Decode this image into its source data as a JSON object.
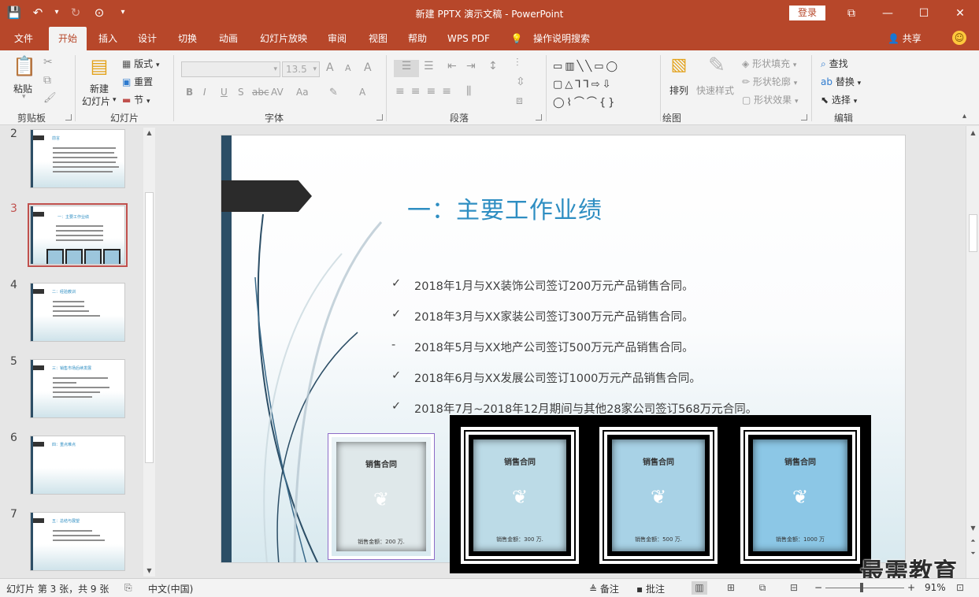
{
  "window": {
    "title": "新建 PPTX 演示文稿 - PowerPoint",
    "login_label": "登录",
    "controls": {
      "ribbon_display": "⧉",
      "minimize": "—",
      "maximize": "☐",
      "close": "✕"
    }
  },
  "qat": {
    "save": "💾",
    "undo": "↶",
    "undo_drop": "▾",
    "redo": "↻",
    "present": "⊙",
    "customize": "▾"
  },
  "tabs": [
    "文件",
    "开始",
    "插入",
    "设计",
    "切换",
    "动画",
    "幻灯片放映",
    "审阅",
    "视图",
    "帮助",
    "WPS PDF",
    "操作说明搜索"
  ],
  "tab_icons": {
    "tell_me": "💡"
  },
  "share_label": "共享",
  "smiley": "☺",
  "ribbon": {
    "clipboard": {
      "label": "剪贴板",
      "paste": "粘贴",
      "paste_icon": "📋",
      "cut": "✂",
      "copy": "⧉",
      "format_painter": "🖌"
    },
    "slides": {
      "label": "幻灯片",
      "new_slide_line1": "新建",
      "new_slide_line2": "幻灯片",
      "layout": "版式",
      "reset": "重置",
      "section": "节"
    },
    "font": {
      "label": "字体",
      "size_value": "13.5",
      "grow": "A",
      "shrink": "A",
      "clear": "A",
      "buttons": [
        "B",
        "I",
        "U",
        "S",
        "abc",
        "AV",
        "Aa",
        "A"
      ]
    },
    "paragraph": {
      "label": "段落"
    },
    "drawing": {
      "label": "绘图",
      "shapes_row1": "▭▥╲╲▭◯",
      "shapes_row2": "▢△⅂⅂⇨⇩",
      "shapes_row3": "◯⌇⌒⌒{}",
      "arrange": "排列",
      "quick_styles": "快速样式",
      "shape_fill": "形状填充",
      "shape_outline": "形状轮廓",
      "shape_effects": "形状效果"
    },
    "editing": {
      "label": "编辑",
      "find": "查找",
      "replace": "替换",
      "select": "选择"
    }
  },
  "thumbnails": [
    {
      "num": "2",
      "title": "前言"
    },
    {
      "num": "3",
      "title": "一：主要工作业绩",
      "active": true
    },
    {
      "num": "4",
      "title": "二：经验教训"
    },
    {
      "num": "5",
      "title": "三：销售市场后续发展"
    },
    {
      "num": "6",
      "title": "四：重点难点"
    },
    {
      "num": "7",
      "title": "五：总结与展望"
    }
  ],
  "slide": {
    "title": "一：主要工作业绩",
    "bullets": [
      {
        "marker": "✓",
        "text": "2018年1月与XX装饰公司签订200万元产品销售合同。"
      },
      {
        "marker": "✓",
        "text": "2018年3月与XX家装公司签订300万元产品销售合同。"
      },
      {
        "marker": "-",
        "text": "2018年5月与XX地产公司签订500万元产品销售合同。"
      },
      {
        "marker": "✓",
        "text": "2018年6月与XX发展公司签订1000万元产品销售合同。"
      },
      {
        "marker": "✓",
        "text": "2018年7月~2018年12月期间与其他28家公司签订568万元合同。"
      }
    ],
    "cards": [
      {
        "title": "销售合同",
        "amount": "销售金额：200 万.",
        "color": "#dfe8ea"
      },
      {
        "title": "销售合同",
        "amount": "销售金额：300 万.",
        "color": "#bcdbe7"
      },
      {
        "title": "销售合同",
        "amount": "销售金额：500 万.",
        "color": "#a8d2e6"
      },
      {
        "title": "销售合同",
        "amount": "销售金额：1000 万",
        "color": "#8cc7e6"
      }
    ],
    "card_icon": "❦"
  },
  "watermark": "最需教育",
  "status": {
    "slide_info": "幻灯片 第 3 张，共 9 张",
    "language": "中文(中国)",
    "notes": "备注",
    "comments": "批注",
    "zoom_minus": "−",
    "zoom_plus": "+",
    "zoom": "91%"
  },
  "colors": {
    "accent": "#b7472a",
    "title_blue": "#2e8ec2",
    "bar_dark": "#2c4e66"
  }
}
